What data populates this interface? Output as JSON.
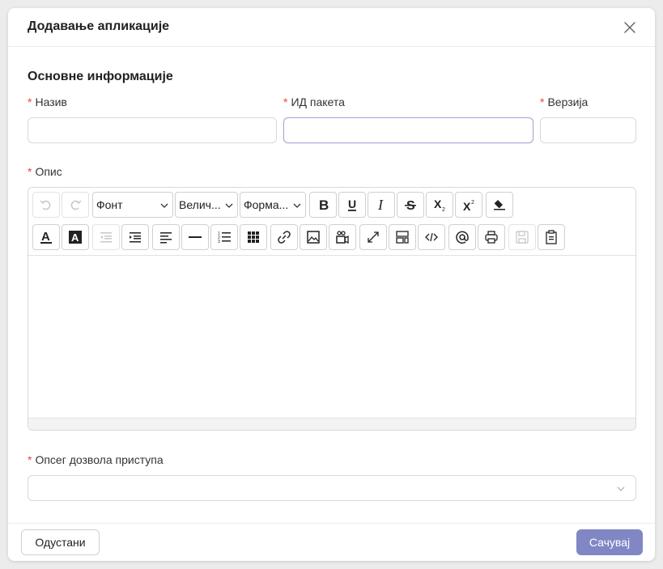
{
  "modal": {
    "title": "Додавање апликације",
    "section_title": "Основне информације"
  },
  "fields": {
    "name": {
      "label": "Назив",
      "value": ""
    },
    "package_id": {
      "label": "ИД пакета",
      "value": ""
    },
    "version": {
      "label": "Верзија",
      "value": ""
    },
    "description": {
      "label": "Опис"
    },
    "scope": {
      "label": "Опсег дозвола приступа",
      "value": ""
    }
  },
  "editor": {
    "selects": {
      "font": "Фонт",
      "size": "Велич...",
      "format": "Форма..."
    },
    "buttons": [
      "undo-icon",
      "redo-icon",
      "bold-icon",
      "underline-icon",
      "italic-icon",
      "strikethrough-icon",
      "subscript-icon",
      "superscript-icon",
      "eraser-icon",
      "font-color-icon",
      "highlight-color-icon",
      "outdent-icon",
      "indent-icon",
      "align-icon",
      "horizontal-rule-icon",
      "list-icon",
      "table-icon",
      "link-icon",
      "image-icon",
      "video-icon",
      "fullscreen-icon",
      "show-blocks-icon",
      "code-view-icon",
      "mention-icon",
      "print-icon",
      "save-icon",
      "template-icon"
    ]
  },
  "footer": {
    "cancel_label": "Одустани",
    "save_label": "Сачувај"
  },
  "colors": {
    "required": "#e34848",
    "primary": "#8087c4",
    "focus_border": "#a9a8d6"
  }
}
